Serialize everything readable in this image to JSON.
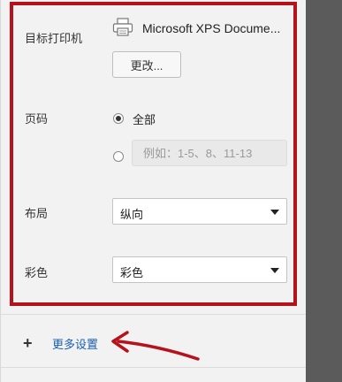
{
  "destination": {
    "label": "目标打印机",
    "printer_name": "Microsoft XPS Docume...",
    "change_button": "更改..."
  },
  "pages": {
    "label": "页码",
    "all_label": "全部",
    "all_selected": true,
    "range_placeholder": "例如：1-5、8、11-13"
  },
  "layout": {
    "label": "布局",
    "value": "纵向"
  },
  "color": {
    "label": "彩色",
    "value": "彩色"
  },
  "more_settings": {
    "label": "更多设置"
  },
  "colors": {
    "highlight": "#b5121b",
    "link": "#1a5fb4"
  }
}
